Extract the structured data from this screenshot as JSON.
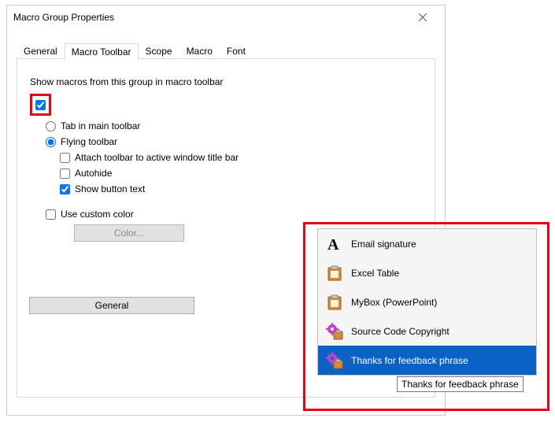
{
  "window": {
    "title": "Macro Group Properties"
  },
  "tabs": {
    "items": [
      {
        "label": "General"
      },
      {
        "label": "Macro Toolbar"
      },
      {
        "label": "Scope"
      },
      {
        "label": "Macro"
      },
      {
        "label": "Font"
      }
    ],
    "active_index": 1
  },
  "content": {
    "show_group_label": "Show macros from this group in macro toolbar",
    "show_group_checked": true,
    "tab_main_label": "Tab in main toolbar",
    "tab_main_selected": false,
    "flying_label": "Flying toolbar",
    "flying_selected": true,
    "attach_label": "Attach toolbar to active window title bar",
    "attach_checked": false,
    "autohide_label": "Autohide",
    "autohide_checked": false,
    "show_button_text_label": "Show button text",
    "show_button_text_checked": true,
    "use_custom_color_label": "Use custom color",
    "use_custom_color_checked": false,
    "color_btn_label": "Color...",
    "big_btn_label": "General"
  },
  "toolbar": {
    "items": [
      {
        "icon": "text",
        "label": "Email signature",
        "selected": false
      },
      {
        "icon": "clip",
        "label": "Excel Table",
        "selected": false
      },
      {
        "icon": "clip",
        "label": "MyBox (PowerPoint)",
        "selected": false
      },
      {
        "icon": "gearclip",
        "label": "Source Code Copyright",
        "selected": false
      },
      {
        "icon": "gearclip",
        "label": "Thanks for feedback phrase",
        "selected": true
      }
    ],
    "tooltip": "Thanks for feedback phrase"
  }
}
